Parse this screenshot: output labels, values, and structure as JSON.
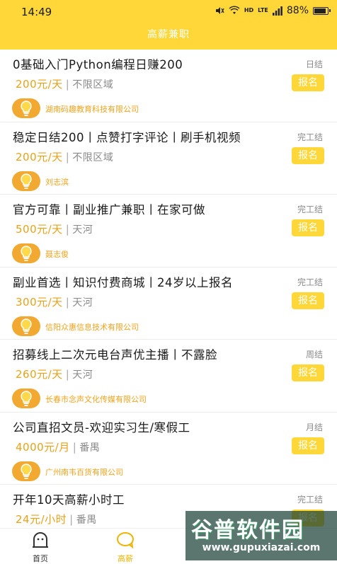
{
  "status_bar": {
    "time": "14:49",
    "network_label": "HD",
    "lte_label": "LTE",
    "battery_percent": "88%",
    "battery_level": 0.88
  },
  "header": {
    "title": "高薪兼职"
  },
  "jobs": [
    {
      "title": "0基础入门Python编程日赚200",
      "settle": "日结",
      "salary": "200元/天",
      "area": "不限区域",
      "signup": "报名",
      "company": "湖南码趣教育科技有限公司"
    },
    {
      "title": "稳定日结200丨点赞打字评论丨刷手机视频",
      "settle": "完工结",
      "salary": "200元/天",
      "area": "不限区域",
      "signup": "报名",
      "company": "刘志滨"
    },
    {
      "title": "官方可靠丨副业推广兼职丨在家可做",
      "settle": "完工结",
      "salary": "500元/天",
      "area": "天河",
      "signup": "报名",
      "company": "聂志俊"
    },
    {
      "title": "副业首选丨知识付费商城丨24岁以上报名",
      "settle": "完工结",
      "salary": "300元/天",
      "area": "天河",
      "signup": "报名",
      "company": "信阳众惠信息技术有限公司"
    },
    {
      "title": "招募线上二次元电台声优主播丨不露脸",
      "settle": "周结",
      "salary": "260元/天",
      "area": "天河",
      "signup": "报名",
      "company": "长春市念声文化传媒有限公司"
    },
    {
      "title": "公司直招文员-欢迎实习生/寒假工",
      "settle": "月结",
      "salary": "4000元/月",
      "area": "番禺",
      "signup": "报名",
      "company": "广州南韦百货有限公司"
    },
    {
      "title": "开年10天高薪小时工",
      "settle": "完工结",
      "salary": "24元/小时",
      "area": "番禺",
      "signup": "报名",
      "company": ""
    }
  ],
  "tabs": [
    {
      "label": "首页",
      "icon": "home-icon",
      "active": false
    },
    {
      "label": "高薪",
      "icon": "chat-bubble-icon",
      "active": true
    }
  ],
  "watermark": {
    "main": "谷普软件园",
    "url": "www.gupuxiazai.com"
  },
  "colors": {
    "accent": "#ffd738",
    "salary": "#e8a21a",
    "company": "#f3a31c",
    "avatar": "#f2a932"
  }
}
